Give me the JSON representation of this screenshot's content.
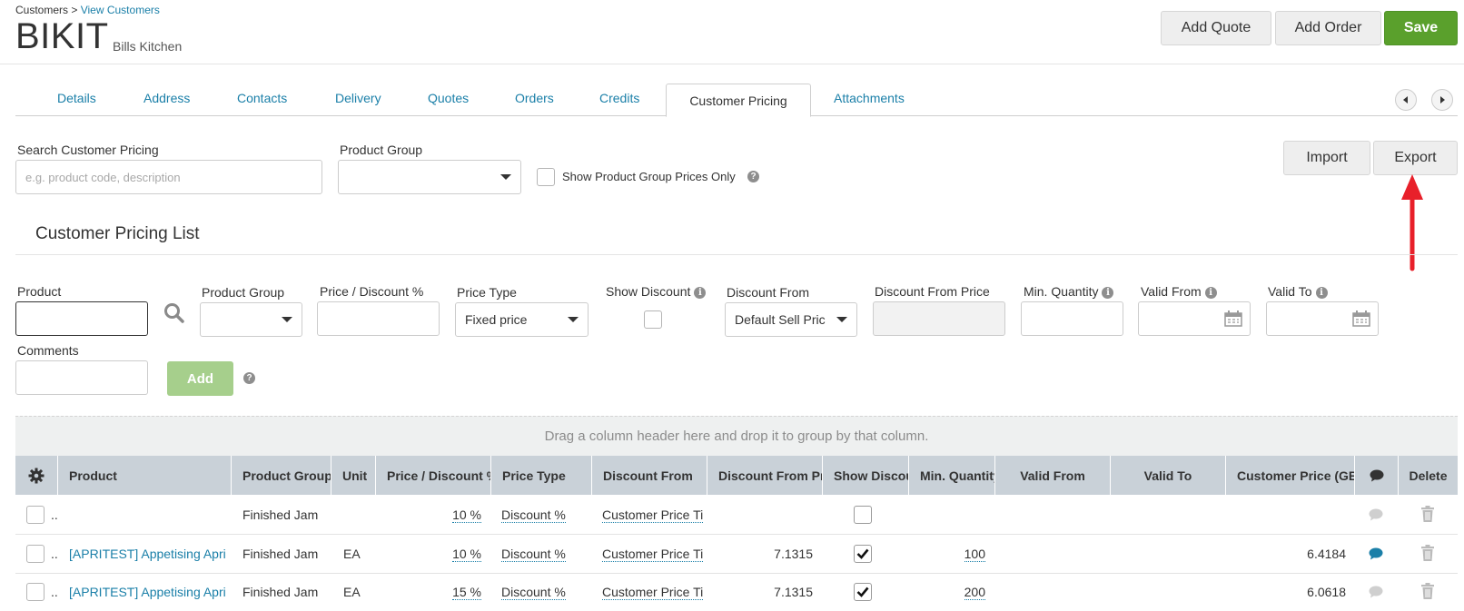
{
  "breadcrumb": {
    "root": "Customers",
    "separator": ">",
    "current": "View Customers"
  },
  "customer": {
    "code": "BIKIT",
    "name": "Bills Kitchen"
  },
  "header_buttons": {
    "add_quote": "Add Quote",
    "add_order": "Add Order",
    "save": "Save"
  },
  "tabs": [
    {
      "label": "Details"
    },
    {
      "label": "Address"
    },
    {
      "label": "Contacts"
    },
    {
      "label": "Delivery"
    },
    {
      "label": "Quotes"
    },
    {
      "label": "Orders"
    },
    {
      "label": "Credits"
    },
    {
      "label": "Customer Pricing"
    },
    {
      "label": "Attachments"
    }
  ],
  "search": {
    "label": "Search Customer Pricing",
    "placeholder": "e.g. product code, description",
    "product_group_label": "Product Group",
    "product_group_value": "",
    "group_only_label": "Show Product Group Prices Only"
  },
  "actions": {
    "import": "Import",
    "export": "Export"
  },
  "section_title": "Customer Pricing List",
  "form": {
    "product_label": "Product",
    "product_group_label": "Product Group",
    "price_label": "Price / Discount %",
    "price_type_label": "Price Type",
    "price_type_value": "Fixed price",
    "show_discount_label": "Show Discount",
    "discount_from_label": "Discount From",
    "discount_from_value": "Default Sell Pric",
    "discount_from_price_label": "Discount From Price",
    "min_qty_label": "Min. Quantity",
    "valid_from_label": "Valid From",
    "valid_to_label": "Valid To",
    "comments_label": "Comments",
    "add_label": "Add"
  },
  "grid": {
    "group_hint": "Drag a column header here and drop it to group by that column.",
    "columns": {
      "product": "Product",
      "product_group": "Product Group",
      "unit": "Unit",
      "price_discount": "Price / Discount %",
      "price_type": "Price Type",
      "discount_from": "Discount From",
      "discount_from_price": "Discount From Pri",
      "show_discount": "Show Discou",
      "min_qty": "Min. Quantity",
      "valid_from": "Valid From",
      "valid_to": "Valid To",
      "customer_price": "Customer Price (GB",
      "delete": "Delete"
    },
    "rows": [
      {
        "dots": "..",
        "product": "",
        "product_group": "Finished Jam",
        "unit": "",
        "price_discount": "10 %",
        "price_type": "Discount %",
        "discount_from": "Customer Price Ti",
        "discount_from_price": "",
        "show_discount": false,
        "min_qty": "",
        "valid_from": "",
        "valid_to": "",
        "customer_price": "",
        "comment": false
      },
      {
        "dots": "..",
        "product": "[APRITEST] Appetising Apri",
        "product_group": "Finished Jam",
        "unit": "EA",
        "price_discount": "10 %",
        "price_type": "Discount %",
        "discount_from": "Customer Price Ti",
        "discount_from_price": "7.1315",
        "show_discount": true,
        "min_qty": "100",
        "valid_from": "",
        "valid_to": "",
        "customer_price": "6.4184",
        "comment": true
      },
      {
        "dots": "..",
        "product": "[APRITEST] Appetising Apri",
        "product_group": "Finished Jam",
        "unit": "EA",
        "price_discount": "15 %",
        "price_type": "Discount %",
        "discount_from": "Customer Price Ti",
        "discount_from_price": "7.1315",
        "show_discount": true,
        "min_qty": "200",
        "valid_from": "",
        "valid_to": "",
        "customer_price": "6.0618",
        "comment": false
      }
    ]
  },
  "colors": {
    "accent": "#1a7fa8",
    "save": "#5aa02c",
    "annotation_arrow": "#e8202a"
  }
}
